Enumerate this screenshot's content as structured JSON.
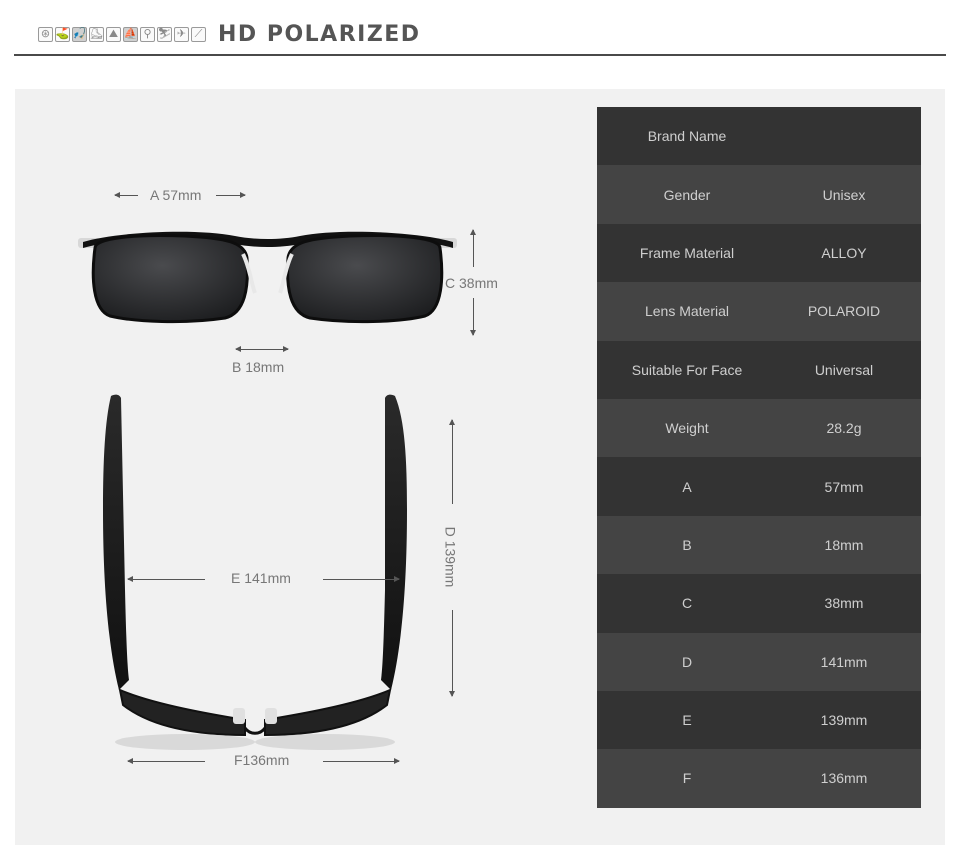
{
  "header": {
    "title": "HD POLARIZED",
    "sport_icons": [
      {
        "name": "steering-wheel-icon",
        "glyph": "⊛"
      },
      {
        "name": "golf-icon",
        "glyph": "⛳"
      },
      {
        "name": "fishing-icon",
        "glyph": "🎣"
      },
      {
        "name": "skating-icon",
        "glyph": "⛸"
      },
      {
        "name": "climbing-icon",
        "glyph": "⛰"
      },
      {
        "name": "boating-icon",
        "glyph": "⛵"
      },
      {
        "name": "cycling-icon",
        "glyph": "⚲"
      },
      {
        "name": "skiing-icon",
        "glyph": "⛷"
      },
      {
        "name": "running-icon",
        "glyph": "✈"
      },
      {
        "name": "snowboard-icon",
        "glyph": "⟋"
      }
    ]
  },
  "diagram": {
    "front": {
      "a": "A 57mm",
      "b": "B 18mm",
      "c": "C 38mm"
    },
    "top": {
      "d": "D 139mm",
      "e": "E 141mm",
      "f": "F136mm"
    }
  },
  "specs": [
    {
      "label": "Brand Name",
      "value": ""
    },
    {
      "label": "Gender",
      "value": "Unisex"
    },
    {
      "label": "Frame Material",
      "value": "ALLOY"
    },
    {
      "label": "Lens Material",
      "value": "POLAROID"
    },
    {
      "label": "Suitable For Face",
      "value": "Universal"
    },
    {
      "label": "Weight",
      "value": "28.2g"
    },
    {
      "label": "A",
      "value": "57mm"
    },
    {
      "label": "B",
      "value": "18mm"
    },
    {
      "label": "C",
      "value": "38mm"
    },
    {
      "label": "D",
      "value": "141mm"
    },
    {
      "label": "E",
      "value": "139mm"
    },
    {
      "label": "F",
      "value": "136mm"
    }
  ]
}
